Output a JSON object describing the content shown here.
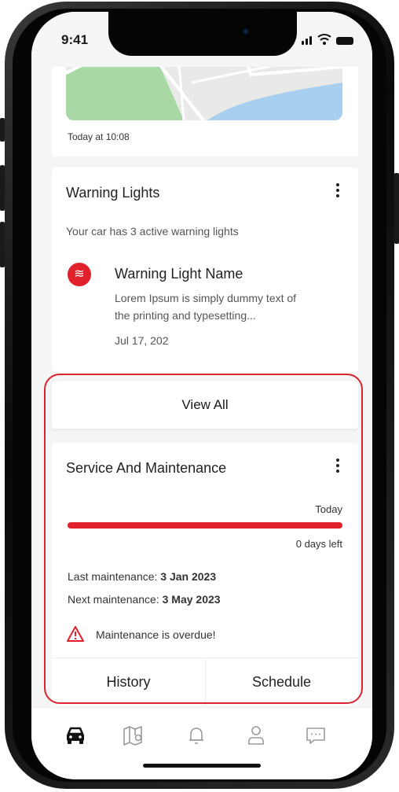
{
  "status": {
    "time": "9:41"
  },
  "map_card": {
    "caption": "Today at 10:08"
  },
  "warning": {
    "title": "Warning Lights",
    "summary": "Your car has 3 active warning lights",
    "item": {
      "icon": "≋",
      "name": "Warning Light Name",
      "desc_line1": "Lorem Ipsum is simply dummy text of",
      "desc_line2": "the printing and typesetting...",
      "date": "Jul 17, 202"
    }
  },
  "view_all": "View All",
  "service": {
    "title": "Service And Maintenance",
    "bar_label": "Today",
    "progress": 1.0,
    "days_left": "0 days left",
    "last_label": "Last maintenance:",
    "last_value": "3 Jan 2023",
    "next_label": "Next maintenance:",
    "next_value": "3 May 2023",
    "alert": "Maintenance is overdue!",
    "history": "History",
    "schedule": "Schedule"
  },
  "tabs": [
    "car-icon",
    "map-icon",
    "bell-icon",
    "profile-icon",
    "chat-icon"
  ],
  "colors": {
    "accent": "#e0202a",
    "highlight": "#d9232d",
    "map_green": "#a8d8a4",
    "map_water": "#a9cff0"
  }
}
